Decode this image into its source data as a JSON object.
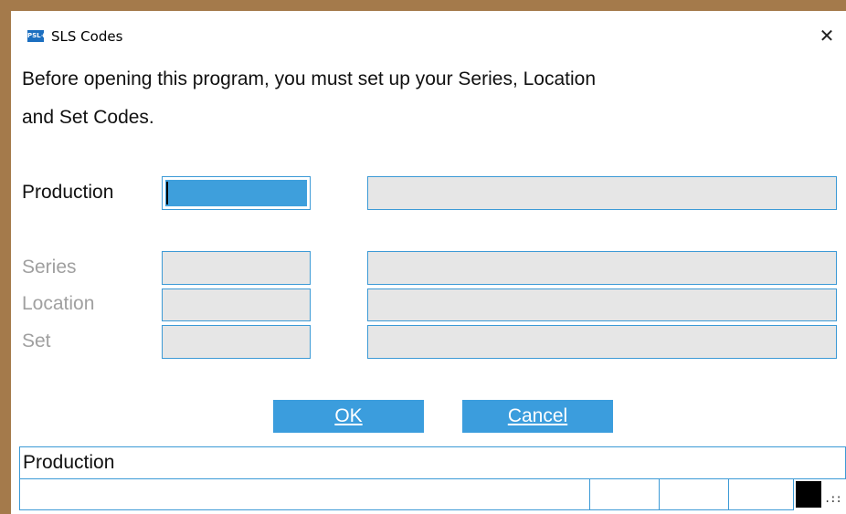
{
  "window": {
    "title": "SLS Codes",
    "app_icon_text": "PSL+",
    "close_glyph": "✕"
  },
  "message": {
    "line1": "Before opening this program, you must set up your Series, Location",
    "line2": "and Set Codes."
  },
  "fields": {
    "production": {
      "label": "Production",
      "code_value": "",
      "description_value": ""
    },
    "series": {
      "label": "Series",
      "code_value": "",
      "description_value": ""
    },
    "location": {
      "label": "Location",
      "code_value": "",
      "description_value": ""
    },
    "set": {
      "label": "Set",
      "code_value": "",
      "description_value": ""
    }
  },
  "buttons": {
    "ok": "OK",
    "cancel": "Cancel"
  },
  "status": {
    "text": "Production",
    "grip": ".::"
  },
  "colors": {
    "accent": "#3b9ddd",
    "frame": "#a47a4b",
    "disabled_text": "#a0a0a0",
    "disabled_field": "#e6e6e6"
  },
  "icons": [
    "app-icon",
    "close-icon",
    "resize-grip-icon"
  ]
}
